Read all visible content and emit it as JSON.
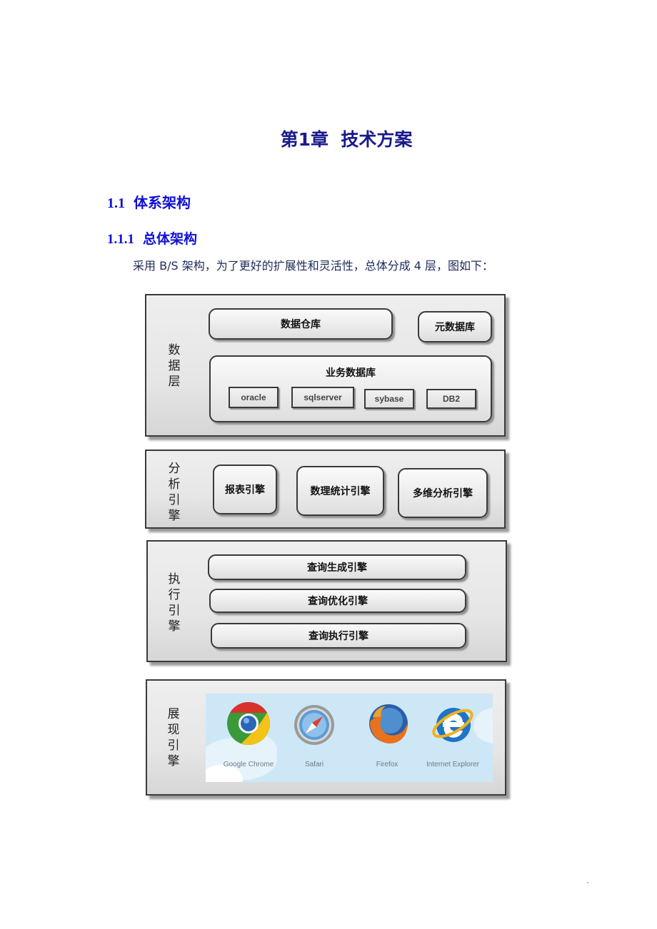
{
  "document": {
    "chapter_title": {
      "number": "第1章",
      "text": "技术方案"
    },
    "section": {
      "number": "1.1",
      "title": "体系架构"
    },
    "subsection": {
      "number": "1.1.1",
      "title": "总体架构"
    },
    "paragraph": "采用 B/S 架构，为了更好的扩展性和灵活性，总体分成 4 层，图如下："
  },
  "diagram": {
    "layers": [
      {
        "label": [
          "数",
          "据",
          "层"
        ],
        "data_warehouse": "数据仓库",
        "metadata_db": "元数据库",
        "business_db": {
          "title": "业务数据库",
          "databases": [
            "oracle",
            "sqlserver",
            "sybase",
            "DB2"
          ]
        }
      },
      {
        "label": [
          "分",
          "析",
          "引",
          "擎"
        ],
        "engines": [
          "报表引擎",
          "数理统计引擎",
          "多维分析引擎"
        ]
      },
      {
        "label": [
          "执",
          "行",
          "引",
          "擎"
        ],
        "engines": [
          "查询生成引擎",
          "查询优化引擎",
          "查询执行引擎"
        ]
      },
      {
        "label": [
          "展",
          "现",
          "引",
          "擎"
        ],
        "browsers": [
          {
            "name": "Google Chrome",
            "icon": "chrome-icon"
          },
          {
            "name": "Safari",
            "icon": "safari-icon"
          },
          {
            "name": "Firefox",
            "icon": "firefox-icon"
          },
          {
            "name": "Internet Explorer",
            "icon": "ie-icon"
          }
        ]
      }
    ]
  },
  "colors": {
    "chapter_title": "#1a1a8c",
    "heading": "#1010d8",
    "body_text": "#1e2a5a",
    "layer_border": "#3a3a3a",
    "browser_panel_bg": "#cde7f7"
  }
}
